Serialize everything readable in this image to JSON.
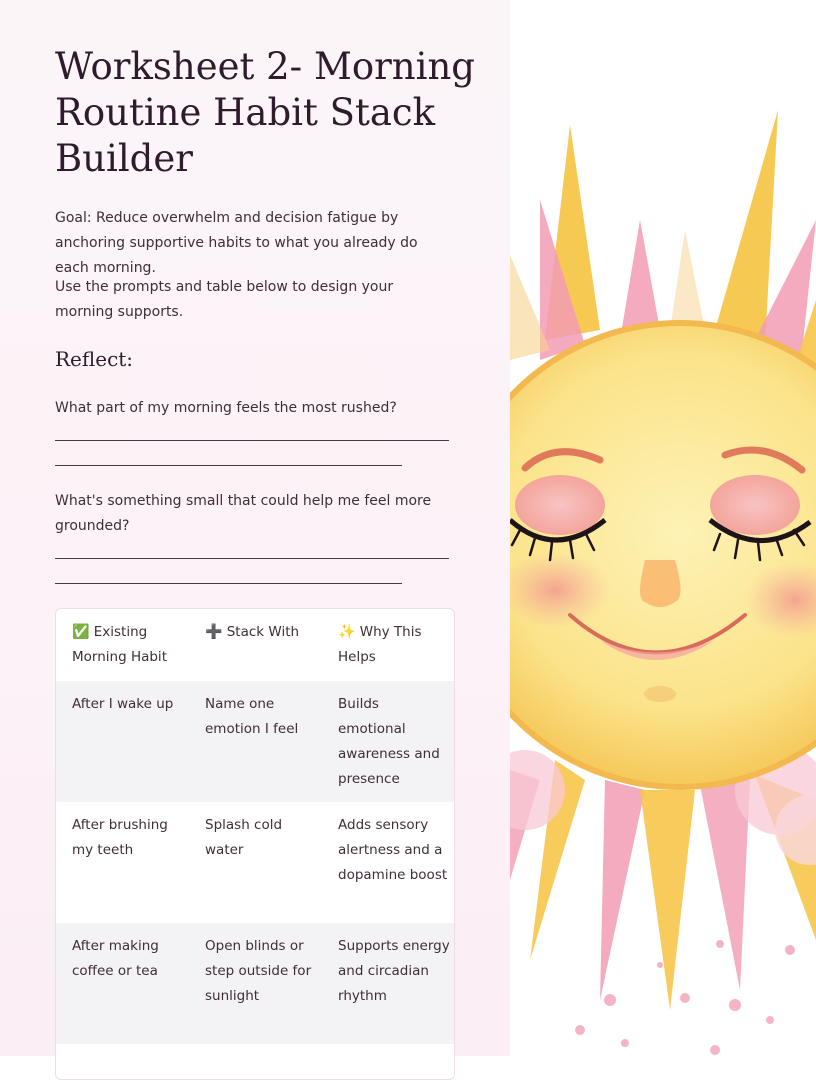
{
  "title": "Worksheet 2- Morning Routine Habit Stack Builder",
  "goal": "Goal: Reduce overwhelm and decision fatigue by anchoring supportive habits to what you already do each morning.",
  "instructions": "Use the prompts and table below to design your morning supports.",
  "reflect_heading": "Reflect:",
  "prompts": [
    "What part of my morning feels the most rushed?",
    "What's something small that could help me feel more grounded?"
  ],
  "table": {
    "headers": [
      {
        "icon": "✅",
        "label": "Existing Morning Habit"
      },
      {
        "icon": "➕",
        "label": "Stack With"
      },
      {
        "icon": "✨",
        "label": "Why This Helps"
      }
    ],
    "rows": [
      [
        "After I wake up",
        "Name one emotion I feel",
        "Builds emotional awareness and presence"
      ],
      [
        "After brushing my teeth",
        "Splash cold water",
        "Adds sensory alertness and a dopamine boost"
      ],
      [
        "After making coffee or tea",
        "Open blinds or step outside for sunlight",
        "Supports energy and circadian rhythm"
      ]
    ]
  },
  "illustration": {
    "subject": "sun-face-icon",
    "colors": {
      "face": "#fbe38a",
      "rays_yellow": "#f6c64a",
      "rays_pink": "#f29bb4",
      "cheeks": "#f49a9a"
    }
  }
}
